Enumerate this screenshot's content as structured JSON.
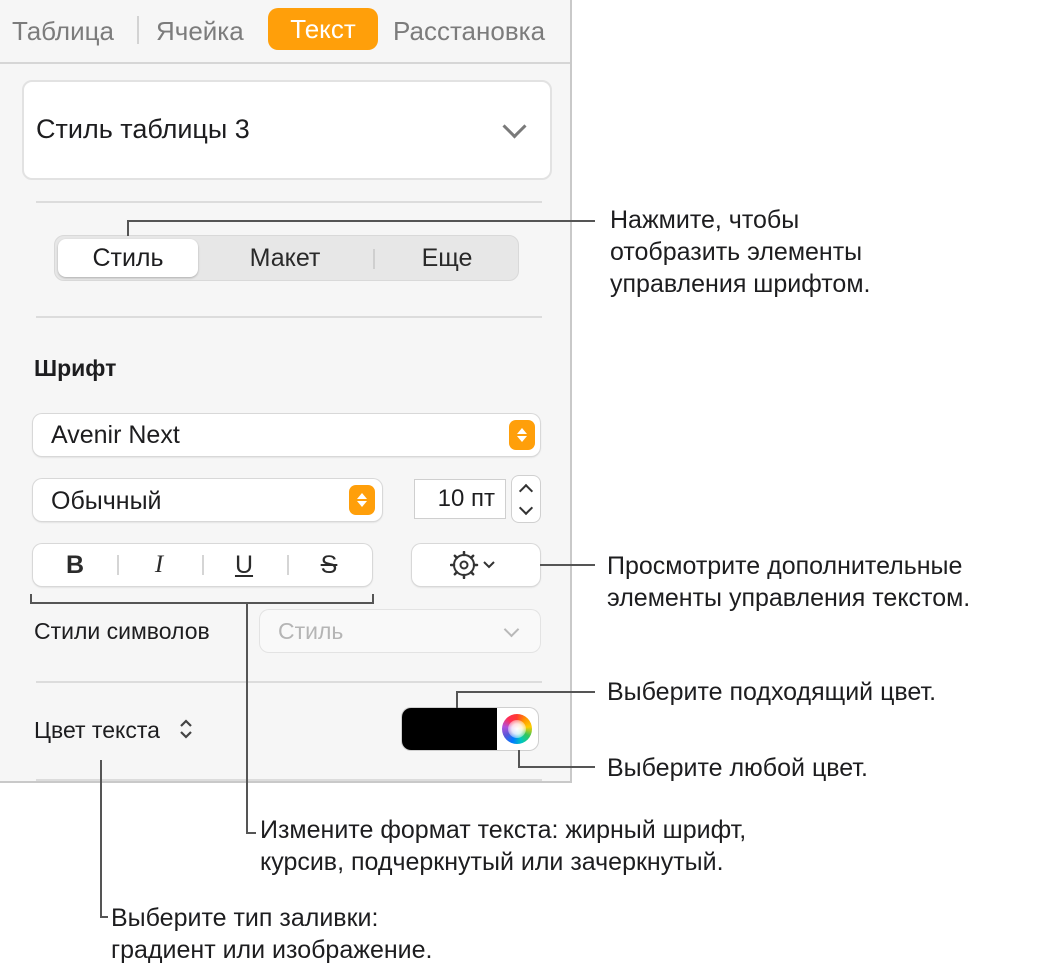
{
  "tabs": {
    "items": [
      {
        "label": "Таблица"
      },
      {
        "label": "Ячейка"
      },
      {
        "label": "Текст"
      },
      {
        "label": "Расстановка"
      }
    ],
    "active": "Текст"
  },
  "table_style": {
    "value": "Стиль таблицы 3"
  },
  "segmented": {
    "items": [
      "Стиль",
      "Макет",
      "Еще"
    ],
    "active": "Стиль"
  },
  "font_section": {
    "title": "Шрифт",
    "family": "Avenir Next",
    "typeface": "Обычный",
    "size": "10 пт",
    "format_buttons": [
      "B",
      "I",
      "U",
      "S"
    ]
  },
  "char_styles": {
    "label": "Стили символов",
    "placeholder": "Стиль"
  },
  "text_color": {
    "label": "Цвет текста",
    "swatch_color": "#000000"
  },
  "accent_color": "#ff9f0a",
  "callouts": {
    "segmented": [
      "Нажмите, чтобы",
      "отобразить элементы",
      "управления шрифтом."
    ],
    "gear": [
      "Просмотрите дополнительные",
      "элементы управления текстом."
    ],
    "swatch": [
      "Выберите подходящий цвет."
    ],
    "wheel": [
      "Выберите любой цвет."
    ],
    "format": [
      "Измените формат текста: жирный шрифт,",
      "курсив, подчеркнутый или зачеркнутый."
    ],
    "fill": [
      "Выберите тип заливки:",
      "градиент или изображение."
    ]
  }
}
